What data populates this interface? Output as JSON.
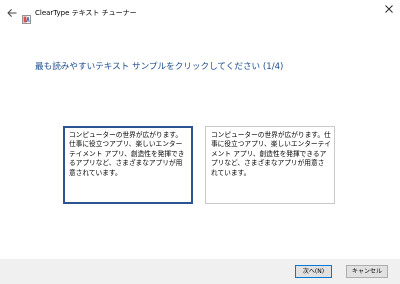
{
  "window": {
    "title": "ClearType テキスト チューナー",
    "back_icon": "arrow-left-icon",
    "app_icon": "cleartype-app-icon",
    "close_icon": "close-icon"
  },
  "main": {
    "heading": "最も読みやすいテキスト サンプルをクリックしてください (1/4)",
    "samples": [
      {
        "text": "コンピューターの世界が広がります。仕事に役立つアプリ、楽しいエンターテイメント アプリ、創造性を発揮できるアプリなど、さまざまなアプリが用意されています。",
        "selected": true
      },
      {
        "text": "コンピューターの世界が広がります。仕事に役立つアプリ、楽しいエンターテイメント アプリ、創造性を発揮できるアプリなど、さまざまなアプリが用意されています。",
        "selected": false
      }
    ]
  },
  "footer": {
    "next_label": "次へ(N)",
    "cancel_label": "キャンセル"
  },
  "colors": {
    "heading": "#1e4e8c",
    "selected_border": "#2b5390",
    "footer_bg": "#f0f0f0",
    "default_button_border": "#0078d7"
  }
}
